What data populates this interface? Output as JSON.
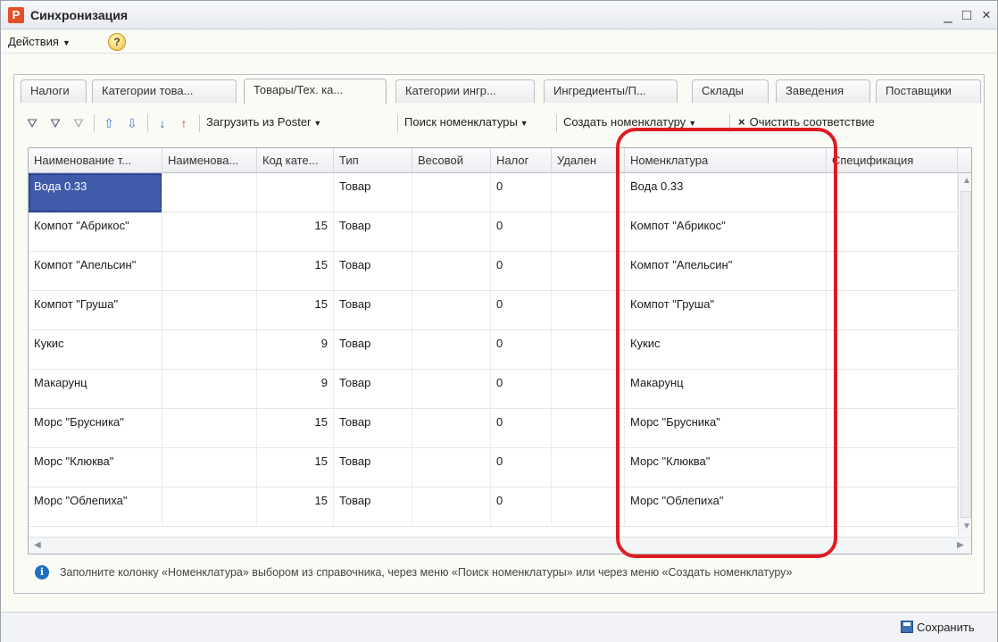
{
  "window": {
    "logo": "P",
    "title": "Синхронизация",
    "controls": {
      "minimize": "_",
      "maximize": "□",
      "close": "×"
    }
  },
  "menu": {
    "actions": "Действия",
    "help": "?"
  },
  "tabs": [
    "Налоги",
    "Категории това...",
    "Товары/Тех. ка...",
    "Категории ингр...",
    "Ингредиенты/П...",
    "Склады",
    "Заведения",
    "Поставщики"
  ],
  "active_tab": 2,
  "toolbar": {
    "load": "Загрузить из Poster",
    "search": "Поиск номенклатуры",
    "create": "Создать номенклатуру",
    "clear": "Очистить соответствие",
    "clear_icon": "×"
  },
  "table": {
    "columns": [
      "Наименование т...",
      "Наименова...",
      "Код кате...",
      "Тип",
      "Весовой",
      "Налог",
      "Удален",
      "Номенклатура",
      "Спецификация"
    ],
    "rows": [
      [
        "Вода 0.33",
        "",
        "",
        "Товар",
        "",
        "0",
        "",
        "Вода 0.33",
        ""
      ],
      [
        "Компот \"Абрикос\"",
        "",
        "15",
        "Товар",
        "",
        "0",
        "",
        "Компот \"Абрикос\"",
        ""
      ],
      [
        "Компот \"Апельсин\"",
        "",
        "15",
        "Товар",
        "",
        "0",
        "",
        "Компот \"Апельсин\"",
        ""
      ],
      [
        "Компот \"Груша\"",
        "",
        "15",
        "Товар",
        "",
        "0",
        "",
        "Компот \"Груша\"",
        ""
      ],
      [
        "Кукис",
        "",
        "9",
        "Товар",
        "",
        "0",
        "",
        "Кукис",
        ""
      ],
      [
        "Макарунц",
        "",
        "9",
        "Товар",
        "",
        "0",
        "",
        "Макарунц",
        ""
      ],
      [
        "Морс \"Брусника\"",
        "",
        "15",
        "Товар",
        "",
        "0",
        "",
        "Морс \"Брусника\"",
        ""
      ],
      [
        "Морс \"Клюква\"",
        "",
        "15",
        "Товар",
        "",
        "0",
        "",
        "Морс \"Клюква\"",
        ""
      ],
      [
        "Морс \"Облепиха\"",
        "",
        "15",
        "Товар",
        "",
        "0",
        "",
        "Морс \"Облепиха\"",
        ""
      ]
    ]
  },
  "info": "Заполните колонку «Номенклатура» выбором из справочника, через меню «Поиск номенклатуры» или через меню «Создать номенклатуру»",
  "status": {
    "save": "Сохранить"
  },
  "colors": {
    "accent": "#3f5ba9",
    "annotation": "#e11b22",
    "logo": "#e2502a"
  }
}
